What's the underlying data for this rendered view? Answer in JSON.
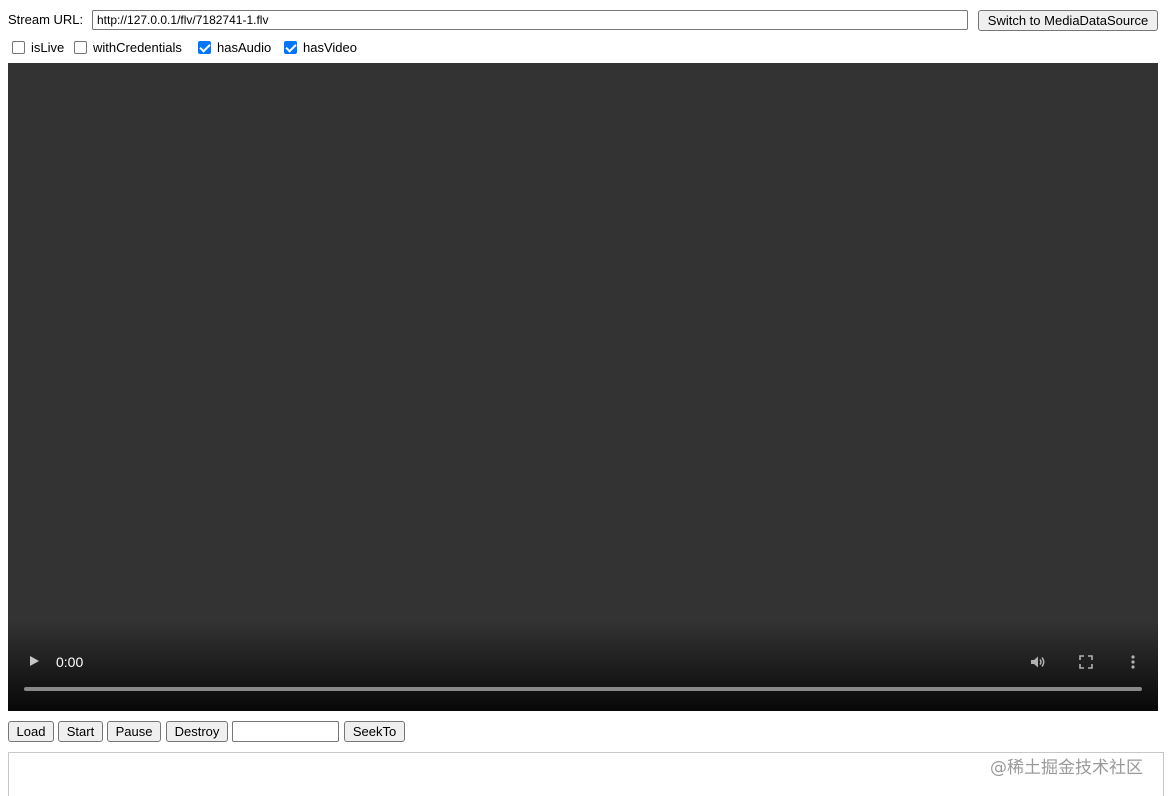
{
  "stream": {
    "label": "Stream URL:",
    "url_value": "http://127.0.0.1/flv/7182741-1.flv",
    "switch_button": "Switch to MediaDataSource"
  },
  "options": [
    {
      "label": "isLive",
      "checked": false
    },
    {
      "label": "withCredentials",
      "checked": false
    },
    {
      "label": "hasAudio",
      "checked": true
    },
    {
      "label": "hasVideo",
      "checked": true
    }
  ],
  "video": {
    "current_time": "0:00",
    "progress_fraction": 0,
    "icons": {
      "play": "play-icon",
      "volume": "volume-icon",
      "fullscreen": "fullscreen-icon",
      "more": "more-options-icon"
    }
  },
  "controls": {
    "load": "Load",
    "start": "Start",
    "pause": "Pause",
    "destroy": "Destroy",
    "seek_value": "",
    "seekto": "SeekTo"
  },
  "watermark": "@稀土掘金技术社区",
  "colors": {
    "video_bg": "#333333",
    "checkbox_checked": "#0075ff"
  }
}
